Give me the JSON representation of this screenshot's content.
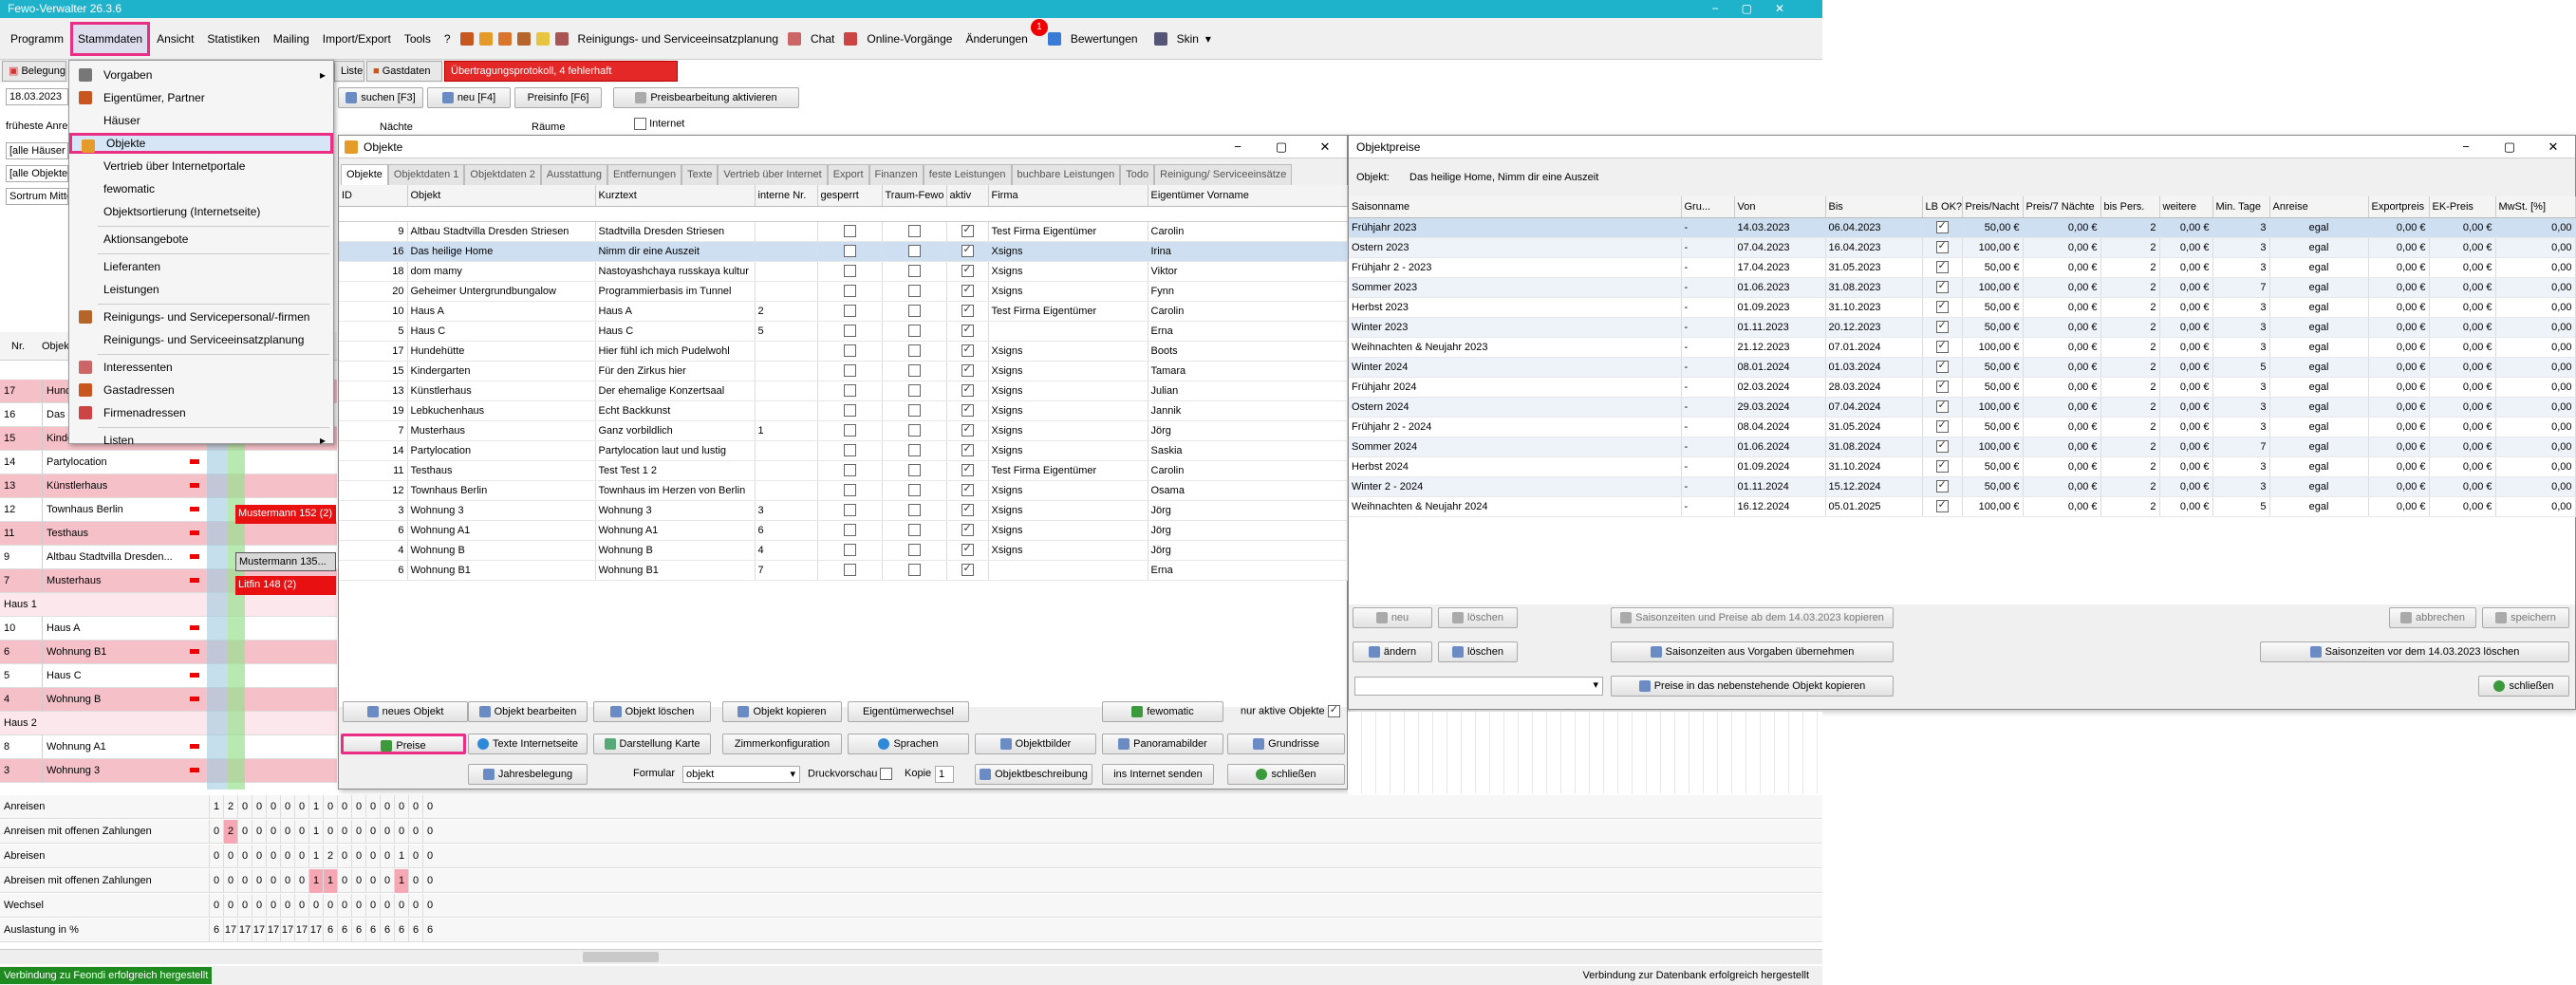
{
  "app": {
    "title": "Fewo-Verwalter 26.3.6"
  },
  "menu": {
    "items": [
      "Programm",
      "Stammdaten",
      "Ansicht",
      "Statistiken",
      "Mailing",
      "Import/Export",
      "Tools",
      "?"
    ],
    "planning": "Reinigungs- und Serviceeinsatzplanung",
    "chat": "Chat",
    "online": "Online-Vorgänge",
    "changes": "Änderungen",
    "changes_badge": "1",
    "ratings": "Bewertungen",
    "skin": "Skin"
  },
  "toolbar2": {
    "belegung": "Belegung",
    "liste": "Liste",
    "gastdaten": "Gastdaten",
    "protocol": "Übertragungsprotokoll, 4 fehlerhaft",
    "date": "18.03.2023",
    "search": "suchen [F3]",
    "new": "neu [F4]",
    "priceinfo": "Preisinfo [F6]",
    "pricebtn": "Preisbearbeitung aktivieren",
    "naechte": "Nächte",
    "raeume": "Räume",
    "internet": "Internet",
    "frueheste": "früheste Anre",
    "alle_haeuser": "[alle Häuser",
    "alle_objekte": "[alle Objekte",
    "sortierung": "Sortrum Mitte"
  },
  "dropdown": {
    "items": [
      {
        "label": "Vorgaben",
        "sub": true
      },
      {
        "label": "Eigentümer, Partner"
      },
      {
        "label": "Häuser"
      },
      {
        "label": "Objekte",
        "highlight": true
      },
      {
        "label": "Vertrieb über Internetportale"
      },
      {
        "label": "fewomatic"
      },
      {
        "label": "Objektsortierung (Internetseite)"
      },
      {
        "label": "Aktionsangebote"
      },
      {
        "label": "Lieferanten"
      },
      {
        "label": "Leistungen"
      },
      {
        "label": "Reinigungs- und Servicepersonal/-firmen"
      },
      {
        "label": "Reinigungs- und Serviceeinsatzplanung"
      },
      {
        "label": "Interessenten"
      },
      {
        "label": "Gastadressen"
      },
      {
        "label": "Firmenadressen"
      },
      {
        "label": "Listen",
        "sub": true
      }
    ]
  },
  "left_grid": {
    "header_nr": "Nr.",
    "header_obj": "Objek",
    "rows": [
      {
        "nr": "17",
        "name": "Hund",
        "pink": true
      },
      {
        "nr": "16",
        "name": "Das h",
        "pink": false
      },
      {
        "nr": "15",
        "name": "Kinde",
        "pink": true
      },
      {
        "nr": "14",
        "name": "Partylocation",
        "pink": false
      },
      {
        "nr": "13",
        "name": "Künstlerhaus",
        "pink": true
      },
      {
        "nr": "12",
        "name": "Townhaus Berlin",
        "pink": false
      },
      {
        "nr": "11",
        "name": "Testhaus",
        "pink": true
      },
      {
        "nr": "9",
        "name": "Altbau Stadtvilla Dresden...",
        "pink": false
      },
      {
        "nr": "7",
        "name": "Musterhaus",
        "pink": true
      }
    ],
    "group1": "Haus 1",
    "rows2": [
      {
        "nr": "10",
        "name": "Haus A",
        "pink": false
      },
      {
        "nr": "6",
        "name": "Wohnung B1",
        "pink": true
      },
      {
        "nr": "5",
        "name": "Haus C",
        "pink": false
      },
      {
        "nr": "4",
        "name": "Wohnung B",
        "pink": true
      }
    ],
    "group2": "Haus 2",
    "rows3": [
      {
        "nr": "8",
        "name": "Wohnung A1",
        "pink": false
      },
      {
        "nr": "3",
        "name": "Wohnung 3",
        "pink": true
      }
    ],
    "bookings": [
      {
        "text": "Mustermann 152 (2)",
        "style": "red"
      },
      {
        "text": "Mustermann 135...",
        "style": "grey"
      },
      {
        "text": "Litfin 148 (2)",
        "style": "red"
      }
    ]
  },
  "objekte": {
    "title": "Objekte",
    "tabs": [
      "Objekte",
      "Objektdaten 1",
      "Objektdaten 2",
      "Ausstattung",
      "Entfernungen",
      "Texte",
      "Vertrieb über Internet",
      "Export",
      "Finanzen",
      "feste Leistungen",
      "buchbare Leistungen",
      "Todo",
      "Reinigung/ Serviceeinsätze"
    ],
    "columns": [
      "ID",
      "Objekt",
      "Kurztext",
      "interne Nr.",
      "gesperrt",
      "Traum-Fewo",
      "aktiv",
      "Firma",
      "Eigentümer Vorname"
    ],
    "rows": [
      {
        "id": "9",
        "obj": "Altbau Stadtvilla Dresden Striesen",
        "kurz": "Stadtvilla Dresden Striesen",
        "nr": "",
        "firma": "Test Firma Eigentümer",
        "vn": "Carolin"
      },
      {
        "id": "16",
        "obj": "Das heilige Home",
        "kurz": "Nimm dir eine Auszeit",
        "nr": "",
        "firma": "Xsigns",
        "vn": "Irina"
      },
      {
        "id": "18",
        "obj": "dom mamy",
        "kurz": "Nastoyashchaya russkaya kultur",
        "nr": "",
        "firma": "Xsigns",
        "vn": "Viktor"
      },
      {
        "id": "20",
        "obj": "Geheimer Untergrundbungalow",
        "kurz": "Programmierbasis im Tunnel",
        "nr": "",
        "firma": "Xsigns",
        "vn": "Fynn"
      },
      {
        "id": "10",
        "obj": "Haus A",
        "kurz": "Haus A",
        "nr": "2",
        "firma": "Test Firma Eigentümer",
        "vn": "Carolin"
      },
      {
        "id": "5",
        "obj": "Haus C",
        "kurz": "Haus C",
        "nr": "5",
        "firma": "",
        "vn": "Erna"
      },
      {
        "id": "17",
        "obj": "Hundehütte",
        "kurz": "Hier fühl ich mich Pudelwohl",
        "nr": "",
        "firma": "Xsigns",
        "vn": "Boots"
      },
      {
        "id": "15",
        "obj": "Kindergarten",
        "kurz": "Für den Zirkus hier",
        "nr": "",
        "firma": "Xsigns",
        "vn": "Tamara"
      },
      {
        "id": "13",
        "obj": "Künstlerhaus",
        "kurz": "Der ehemalige Konzertsaal",
        "nr": "",
        "firma": "Xsigns",
        "vn": "Julian"
      },
      {
        "id": "19",
        "obj": "Lebkuchenhaus",
        "kurz": "Echt Backkunst",
        "nr": "",
        "firma": "Xsigns",
        "vn": "Jannik"
      },
      {
        "id": "7",
        "obj": "Musterhaus",
        "kurz": "Ganz vorbildlich",
        "nr": "1",
        "firma": "Xsigns",
        "vn": "Jörg"
      },
      {
        "id": "14",
        "obj": "Partylocation",
        "kurz": "Partylocation laut und lustig",
        "nr": "",
        "firma": "Xsigns",
        "vn": "Saskia"
      },
      {
        "id": "11",
        "obj": "Testhaus",
        "kurz": "Test Test 1 2",
        "nr": "",
        "firma": "Test Firma Eigentümer",
        "vn": "Carolin"
      },
      {
        "id": "12",
        "obj": "Townhaus Berlin",
        "kurz": "Townhaus im Herzen von Berlin",
        "nr": "",
        "firma": "Xsigns",
        "vn": "Osama"
      },
      {
        "id": "3",
        "obj": "Wohnung 3",
        "kurz": "Wohnung 3",
        "nr": "3",
        "firma": "Xsigns",
        "vn": "Jörg"
      },
      {
        "id": "6",
        "obj": "Wohnung A1",
        "kurz": "Wohnung A1",
        "nr": "6",
        "firma": "Xsigns",
        "vn": "Jörg"
      },
      {
        "id": "4",
        "obj": "Wohnung B",
        "kurz": "Wohnung B",
        "nr": "4",
        "firma": "Xsigns",
        "vn": "Jörg"
      },
      {
        "id": "6",
        "obj": "Wohnung B1",
        "kurz": "Wohnung B1",
        "nr": "7",
        "firma": "",
        "vn": "Erna"
      }
    ],
    "buttons": {
      "neu": "neues Objekt",
      "bearbeiten": "Objekt bearbeiten",
      "loeschen": "Objekt löschen",
      "kopieren": "Objekt kopieren",
      "eigentuemer": "Eigentümerwechsel",
      "fewomatic": "fewomatic",
      "nuraktive": "nur aktive Objekte",
      "preise": "Preise",
      "texte": "Texte Internetseite",
      "karte": "Darstellung Karte",
      "zimmer": "Zimmerkonfiguration",
      "sprachen": "Sprachen",
      "objektbilder": "Objektbilder",
      "panorama": "Panoramabilder",
      "grundrisse": "Grundrisse",
      "jahres": "Jahresbelegung",
      "formular": "Formular",
      "formular_val": "objekt",
      "druckvorschau": "Druckvorschau",
      "kopie": "Kopie",
      "kopie_val": "1",
      "beschreibung": "Objektbeschreibung",
      "internet": "ins Internet senden",
      "schliessen": "schließen"
    }
  },
  "preise": {
    "title": "Objektpreise",
    "objekt_label": "Objekt:",
    "objekt_val": "Das heilige Home, Nimm dir eine Auszeit",
    "columns": [
      "Saisonname",
      "Gru...",
      "Von",
      "Bis",
      "LB OK?",
      "Preis/Nacht",
      "Preis/7 Nächte",
      "bis Pers.",
      "weitere",
      "Min. Tage",
      "Anreise",
      "Exportpreis",
      "EK-Preis",
      "MwSt. [%]"
    ],
    "rows": [
      {
        "name": "Frühjahr 2023",
        "von": "14.03.2023",
        "bis": "06.04.2023",
        "pn": "50,00 €",
        "p7": "0,00 €",
        "bp": "2",
        "we": "0,00 €",
        "mt": "3",
        "an": "egal",
        "ex": "0,00 €",
        "ek": "0,00 €",
        "mw": "0,00"
      },
      {
        "name": "Ostern 2023",
        "von": "07.04.2023",
        "bis": "16.04.2023",
        "pn": "100,00 €",
        "p7": "0,00 €",
        "bp": "2",
        "we": "0,00 €",
        "mt": "3",
        "an": "egal",
        "ex": "0,00 €",
        "ek": "0,00 €",
        "mw": "0,00"
      },
      {
        "name": "Frühjahr 2 - 2023",
        "von": "17.04.2023",
        "bis": "31.05.2023",
        "pn": "50,00 €",
        "p7": "0,00 €",
        "bp": "2",
        "we": "0,00 €",
        "mt": "3",
        "an": "egal",
        "ex": "0,00 €",
        "ek": "0,00 €",
        "mw": "0,00"
      },
      {
        "name": "Sommer 2023",
        "von": "01.06.2023",
        "bis": "31.08.2023",
        "pn": "100,00 €",
        "p7": "0,00 €",
        "bp": "2",
        "we": "0,00 €",
        "mt": "7",
        "an": "egal",
        "ex": "0,00 €",
        "ek": "0,00 €",
        "mw": "0,00"
      },
      {
        "name": "Herbst 2023",
        "von": "01.09.2023",
        "bis": "31.10.2023",
        "pn": "50,00 €",
        "p7": "0,00 €",
        "bp": "2",
        "we": "0,00 €",
        "mt": "3",
        "an": "egal",
        "ex": "0,00 €",
        "ek": "0,00 €",
        "mw": "0,00"
      },
      {
        "name": "Winter 2023",
        "von": "01.11.2023",
        "bis": "20.12.2023",
        "pn": "50,00 €",
        "p7": "0,00 €",
        "bp": "2",
        "we": "0,00 €",
        "mt": "3",
        "an": "egal",
        "ex": "0,00 €",
        "ek": "0,00 €",
        "mw": "0,00"
      },
      {
        "name": "Weihnachten & Neujahr 2023",
        "von": "21.12.2023",
        "bis": "07.01.2024",
        "pn": "100,00 €",
        "p7": "0,00 €",
        "bp": "2",
        "we": "0,00 €",
        "mt": "3",
        "an": "egal",
        "ex": "0,00 €",
        "ek": "0,00 €",
        "mw": "0,00"
      },
      {
        "name": "Winter 2024",
        "von": "08.01.2024",
        "bis": "01.03.2024",
        "pn": "50,00 €",
        "p7": "0,00 €",
        "bp": "2",
        "we": "0,00 €",
        "mt": "5",
        "an": "egal",
        "ex": "0,00 €",
        "ek": "0,00 €",
        "mw": "0,00"
      },
      {
        "name": "Frühjahr 2024",
        "von": "02.03.2024",
        "bis": "28.03.2024",
        "pn": "50,00 €",
        "p7": "0,00 €",
        "bp": "2",
        "we": "0,00 €",
        "mt": "3",
        "an": "egal",
        "ex": "0,00 €",
        "ek": "0,00 €",
        "mw": "0,00"
      },
      {
        "name": "Ostern 2024",
        "von": "29.03.2024",
        "bis": "07.04.2024",
        "pn": "100,00 €",
        "p7": "0,00 €",
        "bp": "2",
        "we": "0,00 €",
        "mt": "3",
        "an": "egal",
        "ex": "0,00 €",
        "ek": "0,00 €",
        "mw": "0,00"
      },
      {
        "name": "Frühjahr 2 - 2024",
        "von": "08.04.2024",
        "bis": "31.05.2024",
        "pn": "50,00 €",
        "p7": "0,00 €",
        "bp": "2",
        "we": "0,00 €",
        "mt": "3",
        "an": "egal",
        "ex": "0,00 €",
        "ek": "0,00 €",
        "mw": "0,00"
      },
      {
        "name": "Sommer 2024",
        "von": "01.06.2024",
        "bis": "31.08.2024",
        "pn": "100,00 €",
        "p7": "0,00 €",
        "bp": "2",
        "we": "0,00 €",
        "mt": "7",
        "an": "egal",
        "ex": "0,00 €",
        "ek": "0,00 €",
        "mw": "0,00"
      },
      {
        "name": "Herbst 2024",
        "von": "01.09.2024",
        "bis": "31.10.2024",
        "pn": "50,00 €",
        "p7": "0,00 €",
        "bp": "2",
        "we": "0,00 €",
        "mt": "3",
        "an": "egal",
        "ex": "0,00 €",
        "ek": "0,00 €",
        "mw": "0,00"
      },
      {
        "name": "Winter 2 - 2024",
        "von": "01.11.2024",
        "bis": "15.12.2024",
        "pn": "50,00 €",
        "p7": "0,00 €",
        "bp": "2",
        "we": "0,00 €",
        "mt": "3",
        "an": "egal",
        "ex": "0,00 €",
        "ek": "0,00 €",
        "mw": "0,00"
      },
      {
        "name": "Weihnachten & Neujahr 2024",
        "von": "16.12.2024",
        "bis": "05.01.2025",
        "pn": "100,00 €",
        "p7": "0,00 €",
        "bp": "2",
        "we": "0,00 €",
        "mt": "5",
        "an": "egal",
        "ex": "0,00 €",
        "ek": "0,00 €",
        "mw": "0,00"
      }
    ],
    "buttons": {
      "neu": "neu",
      "loeschen": "löschen",
      "kopieren_ab": "Saisonzeiten und Preise ab dem 14.03.2023 kopieren",
      "abbrechen": "abbrechen",
      "speichern": "speichern",
      "aendern": "ändern",
      "loeschen2": "löschen",
      "vorgaben": "Saisonzeiten aus Vorgaben übernehmen",
      "loeschen_vor": "Saisonzeiten vor dem 14.03.2023 löschen",
      "kopieren_obj": "Preise in das nebenstehende Objekt kopieren",
      "schliessen": "schließen"
    }
  },
  "stats": {
    "rows": [
      {
        "label": "Anreisen",
        "cells": [
          "1",
          "2",
          "0",
          "0",
          "0",
          "0",
          "0",
          "1",
          "0",
          "0",
          "0",
          "0",
          "0",
          "0",
          "0",
          "0"
        ]
      },
      {
        "label": "Anreisen mit offenen Zahlungen",
        "cells": [
          "0",
          "2",
          "0",
          "0",
          "0",
          "0",
          "0",
          "1",
          "0",
          "0",
          "0",
          "0",
          "0",
          "0",
          "0",
          "0"
        ]
      },
      {
        "label": "Abreisen",
        "cells": [
          "0",
          "0",
          "0",
          "0",
          "0",
          "0",
          "0",
          "1",
          "2",
          "0",
          "0",
          "0",
          "0",
          "1",
          "0",
          "0"
        ]
      },
      {
        "label": "Abreisen mit offenen Zahlungen",
        "cells": [
          "0",
          "0",
          "0",
          "0",
          "0",
          "0",
          "0",
          "1",
          "1",
          "0",
          "0",
          "0",
          "0",
          "1",
          "0",
          "0"
        ]
      },
      {
        "label": "Wechsel",
        "cells": [
          "0",
          "0",
          "0",
          "0",
          "0",
          "0",
          "0",
          "0",
          "0",
          "0",
          "0",
          "0",
          "0",
          "0",
          "0",
          "0"
        ]
      },
      {
        "label": "Auslastung in %",
        "cells": [
          "6",
          "17",
          "17",
          "17",
          "17",
          "17",
          "17",
          "17",
          "6",
          "6",
          "6",
          "6",
          "6",
          "6",
          "6",
          "6"
        ]
      }
    ]
  },
  "status": {
    "left": "Verbindung zu Feondi erfolgreich hergestellt",
    "right": "Verbindung zur Datenbank erfolgreich hergestellt"
  }
}
